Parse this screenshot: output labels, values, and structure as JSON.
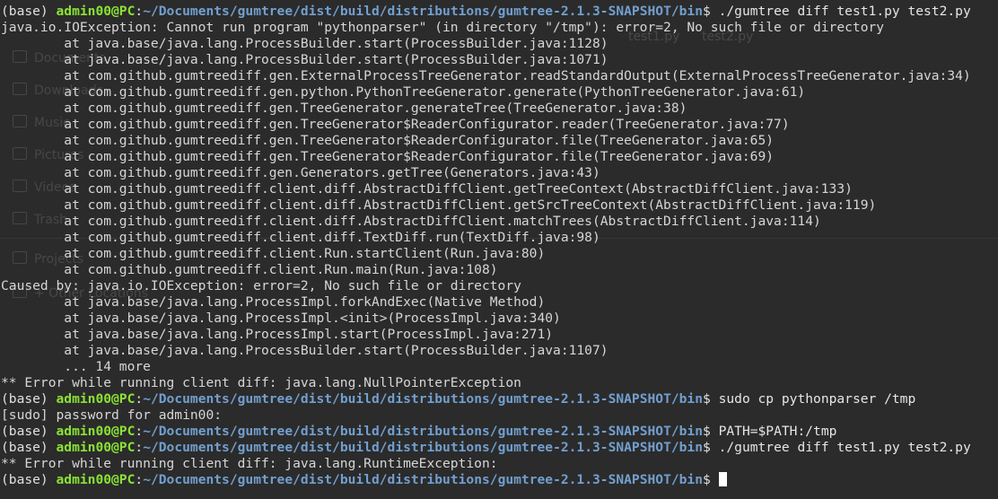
{
  "terminal": {
    "colors": {
      "background": "#2b2b2b",
      "text": "#d6d6d6",
      "user_host": "#8ae234",
      "path": "#729fcf",
      "cursor": "#ffffff"
    },
    "ghost": {
      "sidebar_items": [
        {
          "label": "Documents",
          "icon": "document-icon"
        },
        {
          "label": "Downloads",
          "icon": "download-icon"
        },
        {
          "label": "Music",
          "icon": "music-icon"
        },
        {
          "label": "Pictures",
          "icon": "picture-icon"
        },
        {
          "label": "Videos",
          "icon": "video-icon"
        },
        {
          "label": "Trash",
          "icon": "trash-icon"
        },
        {
          "label": "Projects",
          "icon": "folder-icon"
        },
        {
          "label": "+ Other Locations",
          "icon": "plus-icon"
        }
      ],
      "files": [
        "test1.py",
        "test2.py"
      ]
    },
    "lines": [
      {
        "type": "prompt",
        "env": "(base) ",
        "user": "admin00@PC",
        "sep": ":",
        "path": "~/Documents/gumtree/dist/build/distributions/gumtree-2.1.3-SNAPSHOT/bin",
        "dollar": "$ ",
        "cmd": "./gumtree diff test1.py test2.py"
      },
      {
        "type": "out",
        "text": "java.io.IOException: Cannot run program \"pythonparser\" (in directory \"/tmp\"): error=2, No such file or directory"
      },
      {
        "type": "out",
        "text": "        at java.base/java.lang.ProcessBuilder.start(ProcessBuilder.java:1128)"
      },
      {
        "type": "out",
        "text": "        at java.base/java.lang.ProcessBuilder.start(ProcessBuilder.java:1071)"
      },
      {
        "type": "out",
        "text": "        at com.github.gumtreediff.gen.ExternalProcessTreeGenerator.readStandardOutput(ExternalProcessTreeGenerator.java:34)"
      },
      {
        "type": "out",
        "text": "        at com.github.gumtreediff.gen.python.PythonTreeGenerator.generate(PythonTreeGenerator.java:61)"
      },
      {
        "type": "out",
        "text": "        at com.github.gumtreediff.gen.TreeGenerator.generateTree(TreeGenerator.java:38)"
      },
      {
        "type": "out",
        "text": "        at com.github.gumtreediff.gen.TreeGenerator$ReaderConfigurator.reader(TreeGenerator.java:77)"
      },
      {
        "type": "out",
        "text": "        at com.github.gumtreediff.gen.TreeGenerator$ReaderConfigurator.file(TreeGenerator.java:65)"
      },
      {
        "type": "out",
        "text": "        at com.github.gumtreediff.gen.TreeGenerator$ReaderConfigurator.file(TreeGenerator.java:69)"
      },
      {
        "type": "out",
        "text": "        at com.github.gumtreediff.gen.Generators.getTree(Generators.java:43)"
      },
      {
        "type": "out",
        "text": "        at com.github.gumtreediff.client.diff.AbstractDiffClient.getTreeContext(AbstractDiffClient.java:133)"
      },
      {
        "type": "out",
        "text": "        at com.github.gumtreediff.client.diff.AbstractDiffClient.getSrcTreeContext(AbstractDiffClient.java:119)"
      },
      {
        "type": "out",
        "text": "        at com.github.gumtreediff.client.diff.AbstractDiffClient.matchTrees(AbstractDiffClient.java:114)"
      },
      {
        "type": "out",
        "text": "        at com.github.gumtreediff.client.diff.TextDiff.run(TextDiff.java:98)"
      },
      {
        "type": "out",
        "text": "        at com.github.gumtreediff.client.Run.startClient(Run.java:80)"
      },
      {
        "type": "out",
        "text": "        at com.github.gumtreediff.client.Run.main(Run.java:108)"
      },
      {
        "type": "out",
        "text": "Caused by: java.io.IOException: error=2, No such file or directory"
      },
      {
        "type": "out",
        "text": "        at java.base/java.lang.ProcessImpl.forkAndExec(Native Method)"
      },
      {
        "type": "out",
        "text": "        at java.base/java.lang.ProcessImpl.<init>(ProcessImpl.java:340)"
      },
      {
        "type": "out",
        "text": "        at java.base/java.lang.ProcessImpl.start(ProcessImpl.java:271)"
      },
      {
        "type": "out",
        "text": "        at java.base/java.lang.ProcessBuilder.start(ProcessBuilder.java:1107)"
      },
      {
        "type": "out",
        "text": "        ... 14 more"
      },
      {
        "type": "out",
        "text": "** Error while running client diff: java.lang.NullPointerException"
      },
      {
        "type": "prompt",
        "env": "(base) ",
        "user": "admin00@PC",
        "sep": ":",
        "path": "~/Documents/gumtree/dist/build/distributions/gumtree-2.1.3-SNAPSHOT/bin",
        "dollar": "$ ",
        "cmd": "sudo cp pythonparser /tmp"
      },
      {
        "type": "out",
        "text": "[sudo] password for admin00:"
      },
      {
        "type": "prompt",
        "env": "(base) ",
        "user": "admin00@PC",
        "sep": ":",
        "path": "~/Documents/gumtree/dist/build/distributions/gumtree-2.1.3-SNAPSHOT/bin",
        "dollar": "$ ",
        "cmd": "PATH=$PATH:/tmp"
      },
      {
        "type": "prompt",
        "env": "(base) ",
        "user": "admin00@PC",
        "sep": ":",
        "path": "~/Documents/gumtree/dist/build/distributions/gumtree-2.1.3-SNAPSHOT/bin",
        "dollar": "$ ",
        "cmd": "./gumtree diff test1.py test2.py"
      },
      {
        "type": "out",
        "text": "** Error while running client diff: java.lang.RuntimeException:"
      },
      {
        "type": "prompt",
        "env": "(base) ",
        "user": "admin00@PC",
        "sep": ":",
        "path": "~/Documents/gumtree/dist/build/distributions/gumtree-2.1.3-SNAPSHOT/bin",
        "dollar": "$ ",
        "cmd": "",
        "cursor": true
      }
    ]
  }
}
